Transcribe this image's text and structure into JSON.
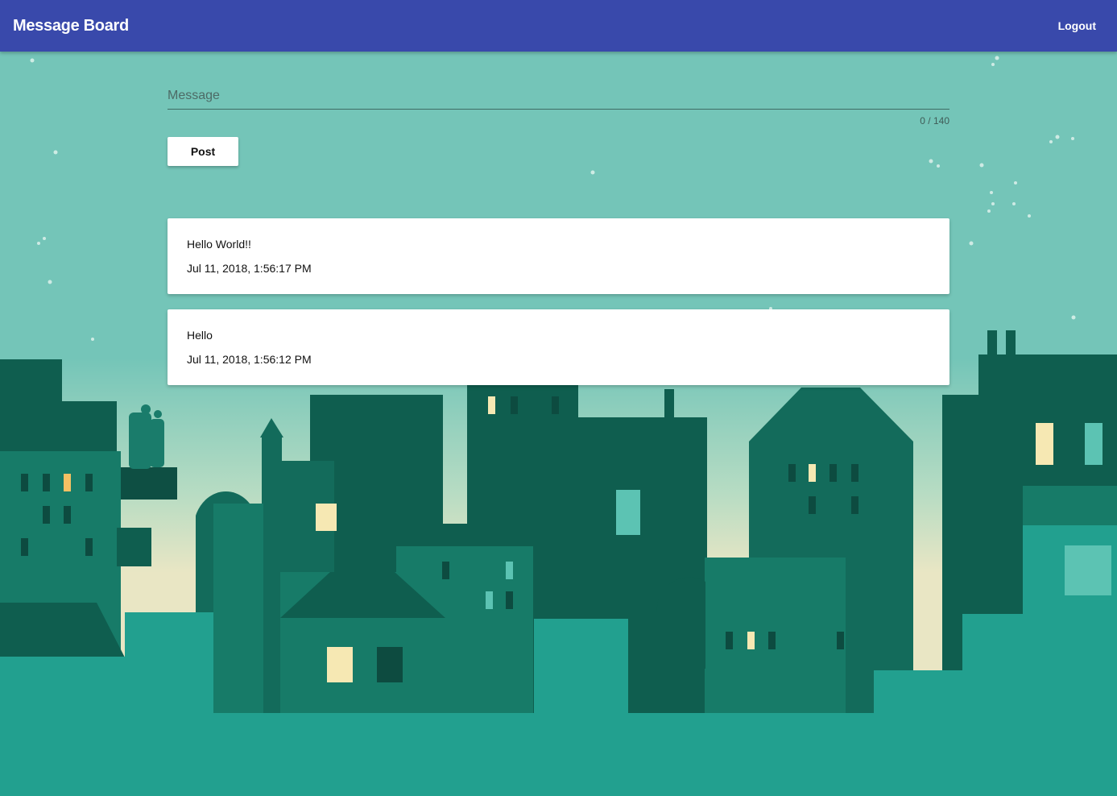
{
  "app": {
    "title": "Message Board",
    "logout_label": "Logout",
    "accent_color": "#3949ab"
  },
  "composer": {
    "placeholder": "Message",
    "value": "",
    "counter": "0 / 140",
    "post_label": "Post"
  },
  "messages": [
    {
      "text": "Hello World!!",
      "timestamp": "Jul 11, 2018, 1:56:17 PM"
    },
    {
      "text": "Hello",
      "timestamp": "Jul 11, 2018, 1:56:12 PM"
    }
  ]
}
